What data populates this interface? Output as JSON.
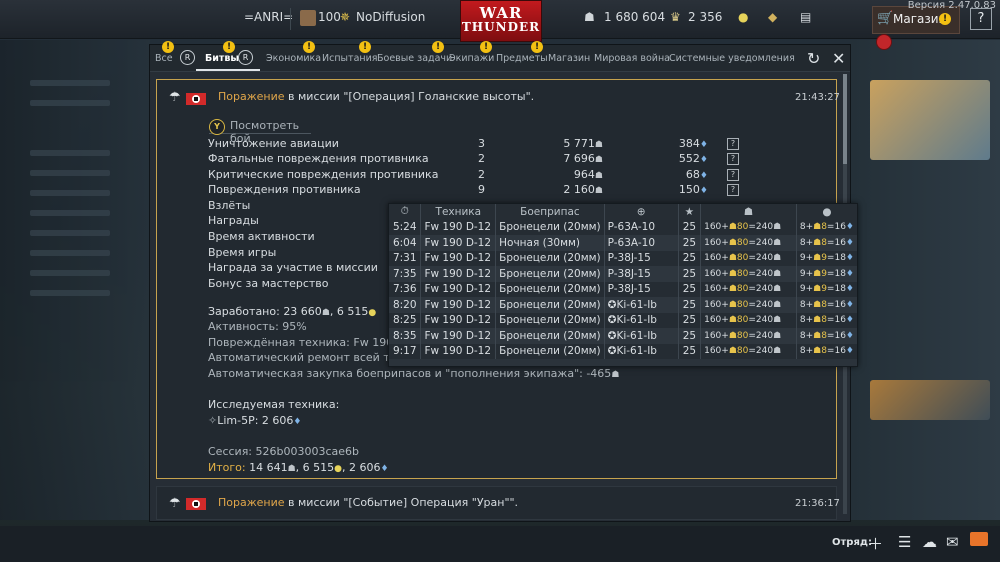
{
  "topbar": {
    "username": "=ANRI=",
    "level": "100",
    "squadron": "NoDiffusion",
    "logo_line1": "WAR",
    "logo_line2": "THUNDER",
    "silver_lions": "1 680 604",
    "golden_eagles": "2 356",
    "shop_label": "Магазин",
    "help_label": "?",
    "version": "Версия 2.47.0.83"
  },
  "tabs": [
    {
      "label": "Все"
    },
    {
      "label": "Битвы"
    },
    {
      "label": "Экономика"
    },
    {
      "label": "Испытания"
    },
    {
      "label": "Боевые задачи"
    },
    {
      "label": "Экипажи"
    },
    {
      "label": "Предметы"
    },
    {
      "label": "Магазин"
    },
    {
      "label": "Мировая война"
    },
    {
      "label": "Системные уведомления"
    }
  ],
  "badges": {
    "warn": "!",
    "r": "R"
  },
  "message1": {
    "result": "Поражение",
    "mission_prefix": " в миссии \"[Операция] Голанские высоты\".",
    "time": "21:43:27",
    "watch_button_key": "Y",
    "watch_button": "Посмотреть бой",
    "rows": [
      {
        "label": "Уничтожение авиации",
        "count": "3",
        "lions": "5 771",
        "rp": "384"
      },
      {
        "label": "Фатальные повреждения противника",
        "count": "2",
        "lions": "7 696",
        "rp": "552"
      },
      {
        "label": "Критические повреждения противника",
        "count": "2",
        "lions": "964",
        "rp": "68"
      },
      {
        "label": "Повреждения противника",
        "count": "9",
        "lions": "2 160",
        "rp": "150"
      },
      {
        "label": "Взлёты"
      },
      {
        "label": "Награды"
      },
      {
        "label": "Время активности"
      },
      {
        "label": "Время игры"
      },
      {
        "label": "Награда за участие в миссии"
      },
      {
        "label": "Бонус за мастерство"
      }
    ],
    "earned_label": "Заработано: ",
    "earned_value": "23 660",
    "earned_ge": ", 6 515",
    "activity": "Активность: 95%",
    "damaged": "Повреждённая техника: Fw 190 D-1",
    "auto_repair": "Автоматический ремонт всей техни",
    "auto_buy": "Автоматическая закупка боеприпасов и \"пополнения экипажа\": -465",
    "researched_label": "Исследуемая техника:",
    "researched_vehicle": "Lim-5P: 2 606",
    "session": "Сессия: 526b003003cae6b",
    "total_label": "Итого:",
    "total_value": " 14 641",
    "total_ge": ", 6 515",
    "total_rp": ", 2 606"
  },
  "message2": {
    "result": "Поражение",
    "mission_prefix": " в миссии \"[Событие] Операция \"Уран\"\".",
    "time": "21:36:17"
  },
  "tooltip": {
    "headers": [
      "Техника",
      "Боеприпас"
    ],
    "rows": [
      {
        "time": "5:24",
        "vehicle": "Fw 190 D-12",
        "ammo": "Бронецели (20мм)",
        "target": "P-63A-10",
        "pts": "25",
        "l1": "160",
        "l2": "80",
        "l3": "240",
        "r1": "8",
        "r2": "8",
        "r3": "16"
      },
      {
        "time": "6:04",
        "vehicle": "Fw 190 D-12",
        "ammo": "Ночная (30мм)",
        "target": "P-63A-10",
        "pts": "25",
        "l1": "160",
        "l2": "80",
        "l3": "240",
        "r1": "8",
        "r2": "8",
        "r3": "16"
      },
      {
        "time": "7:31",
        "vehicle": "Fw 190 D-12",
        "ammo": "Бронецели (20мм)",
        "target": "P-38J-15",
        "pts": "25",
        "l1": "160",
        "l2": "80",
        "l3": "240",
        "r1": "9",
        "r2": "9",
        "r3": "18"
      },
      {
        "time": "7:35",
        "vehicle": "Fw 190 D-12",
        "ammo": "Бронецели (20мм)",
        "target": "P-38J-15",
        "pts": "25",
        "l1": "160",
        "l2": "80",
        "l3": "240",
        "r1": "9",
        "r2": "9",
        "r3": "18"
      },
      {
        "time": "7:36",
        "vehicle": "Fw 190 D-12",
        "ammo": "Бронецели (20мм)",
        "target": "P-38J-15",
        "pts": "25",
        "l1": "160",
        "l2": "80",
        "l3": "240",
        "r1": "9",
        "r2": "9",
        "r3": "18"
      },
      {
        "time": "8:20",
        "vehicle": "Fw 190 D-12",
        "ammo": "Бронецели (20мм)",
        "target": "Ki-61-Ib",
        "pts": "25",
        "l1": "160",
        "l2": "80",
        "l3": "240",
        "r1": "8",
        "r2": "8",
        "r3": "16"
      },
      {
        "time": "8:25",
        "vehicle": "Fw 190 D-12",
        "ammo": "Бронецели (20мм)",
        "target": "Ki-61-Ib",
        "pts": "25",
        "l1": "160",
        "l2": "80",
        "l3": "240",
        "r1": "8",
        "r2": "8",
        "r3": "16"
      },
      {
        "time": "8:35",
        "vehicle": "Fw 190 D-12",
        "ammo": "Бронецели (20мм)",
        "target": "Ki-61-Ib",
        "pts": "25",
        "l1": "160",
        "l2": "80",
        "l3": "240",
        "r1": "8",
        "r2": "8",
        "r3": "16"
      },
      {
        "time": "9:17",
        "vehicle": "Fw 190 D-12",
        "ammo": "Бронецели (20мм)",
        "target": "Ki-61-Ib",
        "pts": "25",
        "l1": "160",
        "l2": "80",
        "l3": "240",
        "r1": "8",
        "r2": "8",
        "r3": "16"
      }
    ]
  },
  "bottombar": {
    "squad_label": "Отряд:"
  },
  "colors": {
    "accent_gold": "#c7a34e",
    "defeat": "#e0a64a",
    "rp_blue": "#7fb3e6",
    "warn_yellow": "#f3c012"
  },
  "icons": [
    "search-icon",
    "reload-icon",
    "close-icon",
    "parachute-icon",
    "lion-icon",
    "rp-icon",
    "eagle-icon",
    "ge-icon",
    "clock-icon",
    "crosshair-icon",
    "star-icon",
    "mail-icon",
    "chat-icon",
    "plus-icon",
    "list-icon"
  ]
}
